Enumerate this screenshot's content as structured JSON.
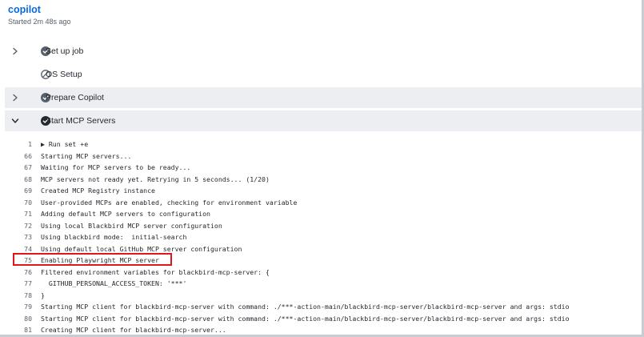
{
  "job": {
    "title": "copilot",
    "subtitle": "Started 2m 48s ago"
  },
  "steps": [
    {
      "label": "Set up job",
      "status": "success",
      "expanded": false
    },
    {
      "label": "OS Setup",
      "status": "skipped",
      "expanded": false
    },
    {
      "label": "Prepare Copilot",
      "status": "success",
      "expanded": false
    },
    {
      "label": "Start MCP Servers",
      "status": "success",
      "expanded": true
    }
  ],
  "log": [
    {
      "n": "1",
      "text": "▶ Run set +e"
    },
    {
      "n": "66",
      "text": "Starting MCP servers..."
    },
    {
      "n": "67",
      "text": "Waiting for MCP servers to be ready..."
    },
    {
      "n": "68",
      "text": "MCP servers not ready yet. Retrying in 5 seconds... (1/20)"
    },
    {
      "n": "69",
      "text": "Created MCP Registry instance"
    },
    {
      "n": "70",
      "text": "User-provided MCPs are enabled, checking for environment variable"
    },
    {
      "n": "71",
      "text": "Adding default MCP servers to configuration"
    },
    {
      "n": "72",
      "text": "Using local Blackbird MCP server configuration"
    },
    {
      "n": "73",
      "text": "Using blackbird mode:  initial-search"
    },
    {
      "n": "74",
      "text": "Using default local GitHub MCP server configuration"
    },
    {
      "n": "75",
      "text": "Enabling Playwright MCP server"
    },
    {
      "n": "76",
      "text": "Filtered environment variables for blackbird-mcp-server: {"
    },
    {
      "n": "77",
      "text": "  GITHUB_PERSONAL_ACCESS_TOKEN: '***'"
    },
    {
      "n": "78",
      "text": "}"
    },
    {
      "n": "79",
      "text": "Starting MCP client for blackbird-mcp-server with command: ./***-action-main/blackbird-mcp-server/blackbird-mcp-server and args: stdio"
    },
    {
      "n": "80",
      "text": "Starting MCP client for blackbird-mcp-server with command: ./***-action-main/blackbird-mcp-server/blackbird-mcp-server and args: stdio"
    },
    {
      "n": "81",
      "text": "Creating MCP client for blackbird-mcp-server..."
    }
  ],
  "highlighted_line": "75",
  "colors": {
    "link": "#0969da",
    "shaded_row": "#eceef1",
    "success_icon": "#24292f",
    "highlight": "#e0161d"
  }
}
